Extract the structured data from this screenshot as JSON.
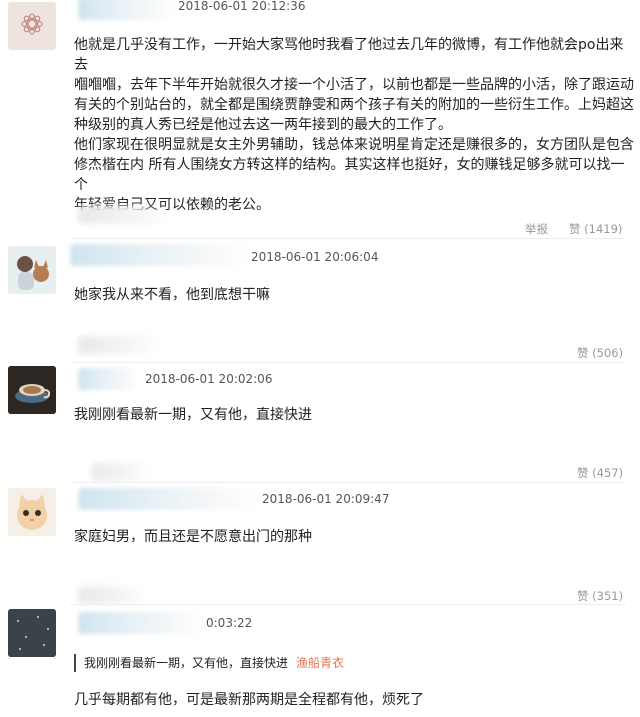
{
  "comments": [
    {
      "timestamp": "2018-06-01 20:12:36",
      "lines": [
        "他就是几乎没有工作，一开始大家骂他时我看了他过去几年的微博，有工作他就会po出来去",
        "嗰嗰嗰，去年下半年开始就很久才接一个小活了，以前也都是一些品牌的小活，除了跟运动",
        "有关的个别站台的，就全都是围绕贾静雯和两个孩子有关的附加的一些衍生工作。上妈超这",
        "种级别的真人秀已经是他过去这一两年接到的最大的工作了。",
        "他们家现在很明显就是女主外男辅助，钱总体来说明星肯定还是赚很多的，女方团队是包含",
        "修杰楷在内 所有人围绕女方转这样的结构。其实这样也挺好，女的赚钱足够多就可以找一个",
        "年轻爱自己又可以依赖的老公。"
      ],
      "report_label": "举报",
      "like_label": "赞",
      "like_count": "(1419)"
    },
    {
      "timestamp": "2018-06-01 20:06:04",
      "text": "她家我从来不看，他到底想干嘛",
      "like_label": "赞",
      "like_count": "(506)"
    },
    {
      "timestamp": "2018-06-01 20:02:06",
      "text": "我刚刚看最新一期，又有他，直接快进",
      "like_label": "赞",
      "like_count": "(457)"
    },
    {
      "timestamp": "2018-06-01 20:09:47",
      "text": "家庭妇男，而且还是不愿意出门的那种",
      "like_label": "赞",
      "like_count": "(351)"
    },
    {
      "timestamp": "0:03:22",
      "quote_text": "我刚刚看最新一期，又有他，直接快进",
      "quote_name": "渔船青衣",
      "text": "几乎每期都有他，可是最新那两期是全程都有他，烦死了"
    }
  ],
  "colors": {
    "link": "#eb7350",
    "muted": "#999999",
    "text": "#222222"
  }
}
